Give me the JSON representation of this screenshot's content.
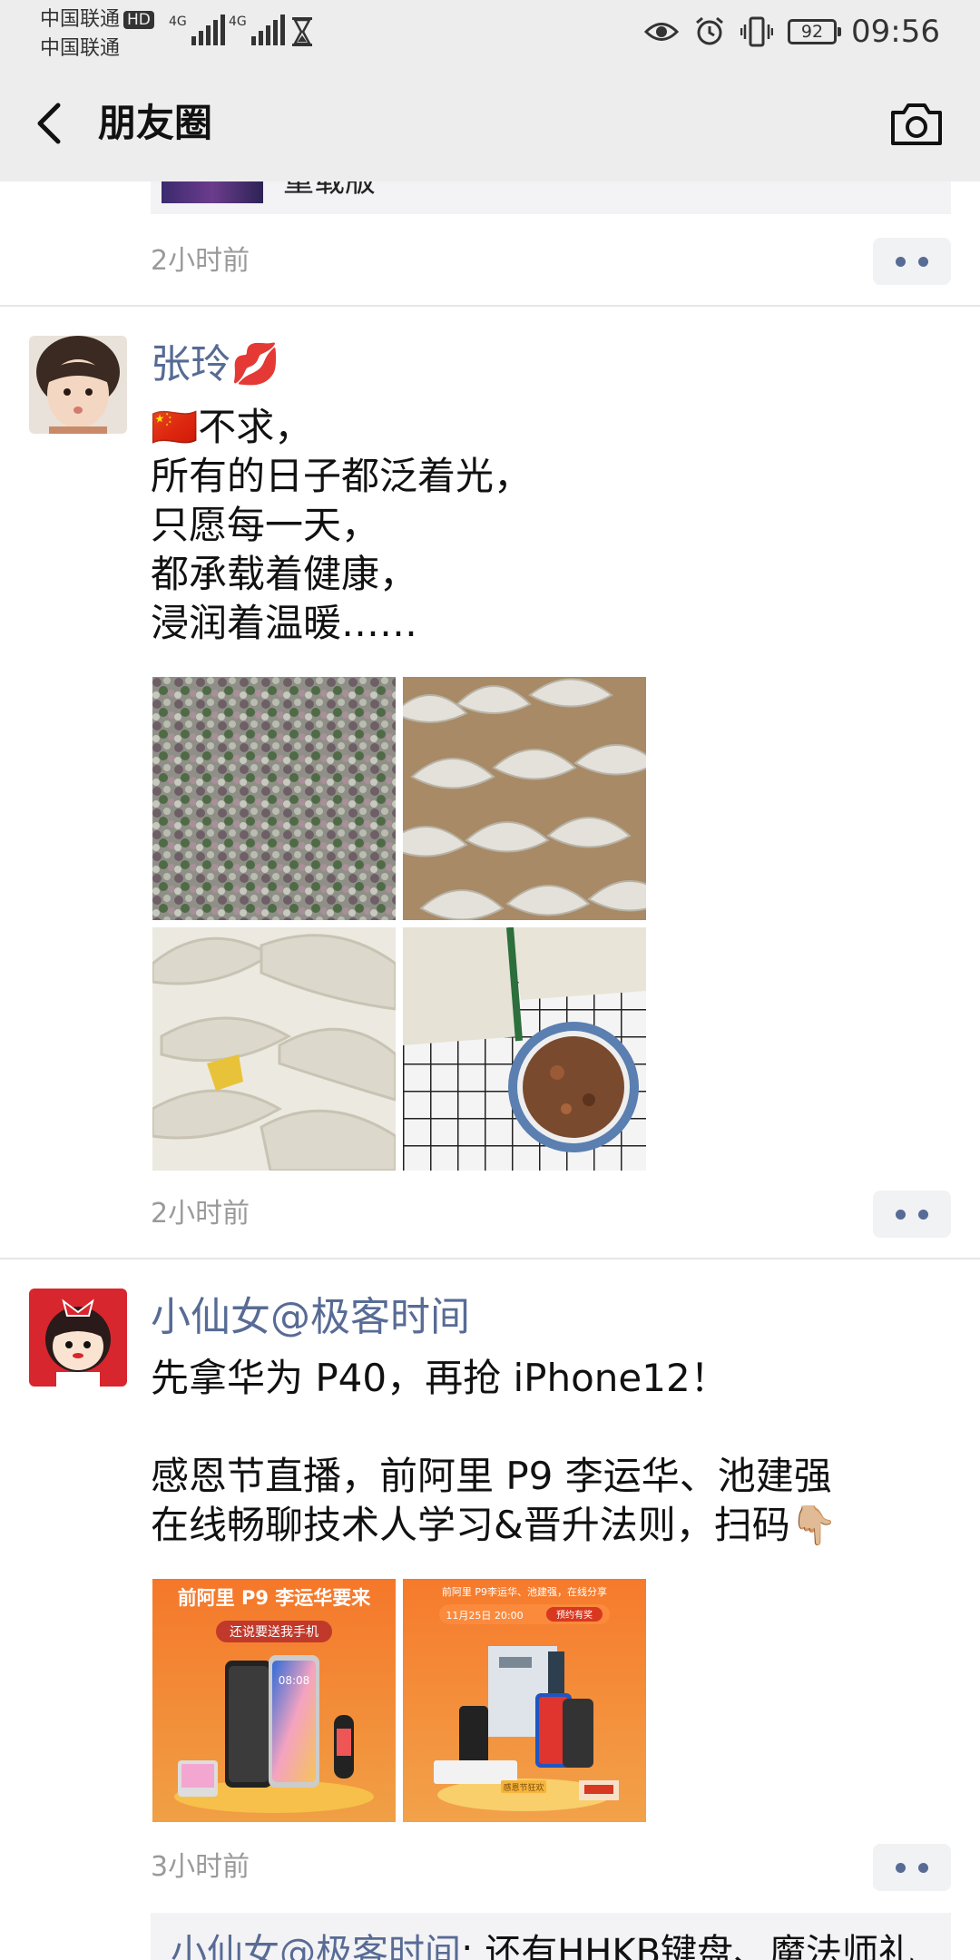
{
  "status_bar": {
    "carrier_1": "中国联通",
    "hd_badge": "HD",
    "carrier_2": "中国联通",
    "signal_label_1": "4G",
    "signal_label_2": "4G",
    "battery": "92",
    "time": "09:56"
  },
  "header": {
    "title": "朋友圈"
  },
  "previous_post": {
    "link_text": "重载版",
    "time": "2小时前"
  },
  "posts": [
    {
      "nickname": "张玲💋",
      "lines": [
        "🇨🇳不求，",
        "所有的日子都泛着光，",
        "只愿每一天，",
        "都承载着健康，",
        "浸润着温暖……"
      ],
      "photo_count": 4,
      "time": "2小时前"
    },
    {
      "nickname": "小仙女@极客时间",
      "lines": [
        "先拿华为 P40，再抢 iPhone12！",
        "",
        "感恩节直播，前阿里 P9 李运华、池建强",
        "在线畅聊技术人学习&晋升法则，扫码👇🏼"
      ],
      "ads": [
        {
          "headline": "前阿里 P9 李运华要来",
          "pill": "还说要送我手机",
          "screen_time": "08:08"
        },
        {
          "headline": "前阿里 P9李运华、池建强，在线分享",
          "pill": "11月25日 20:00",
          "tag": "预约有奖",
          "stage": "感恩节狂欢"
        }
      ],
      "time": "3小时前",
      "comment": {
        "author": "小仙女@极客时间",
        "text": ": 还有HHKB键盘、魔法师礼"
      }
    }
  ],
  "colors": {
    "link_blue": "#576b95",
    "header_bg": "#ededed",
    "muted_text": "#9a9a9a"
  },
  "icons": {
    "back": "chevron-left-icon",
    "camera": "camera-icon",
    "eye": "eye-icon",
    "alarm": "alarm-icon",
    "vibrate": "vibrate-icon",
    "hourglass": "hourglass-icon",
    "more": "more-dots-icon"
  }
}
